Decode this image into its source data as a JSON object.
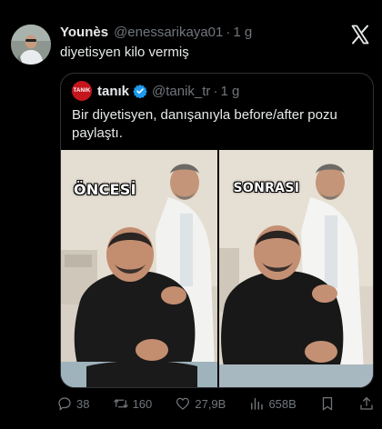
{
  "tweet": {
    "display_name": "Younès",
    "handle": "@enessarikaya01",
    "separator": "·",
    "time": "1 g",
    "text": "diyetisyen kilo vermiş"
  },
  "quote": {
    "avatar_text": "TANIK",
    "display_name": "tanık",
    "verified_icon": "verified-badge-icon",
    "handle": "@tanik_tr",
    "separator": "·",
    "time": "1 g",
    "text": "Bir diyetisyen, danışanıyla before/after pozu paylaştı.",
    "media": [
      {
        "label": "ÖNCESİ"
      },
      {
        "label": "SONRASI"
      }
    ]
  },
  "actions": {
    "reply": {
      "icon": "reply-icon",
      "count": "38"
    },
    "retweet": {
      "icon": "retweet-icon",
      "count": "160"
    },
    "like": {
      "icon": "heart-icon",
      "count": "27,9B"
    },
    "views": {
      "icon": "views-icon",
      "count": "658B"
    },
    "bookmark": {
      "icon": "bookmark-icon"
    },
    "share": {
      "icon": "share-icon"
    }
  },
  "colors": {
    "background": "#000000",
    "text": "#e7e9ea",
    "muted": "#71767b",
    "border": "#2f3336",
    "verified": "#1d9bf0",
    "quote_avatar": "#c4161c"
  }
}
